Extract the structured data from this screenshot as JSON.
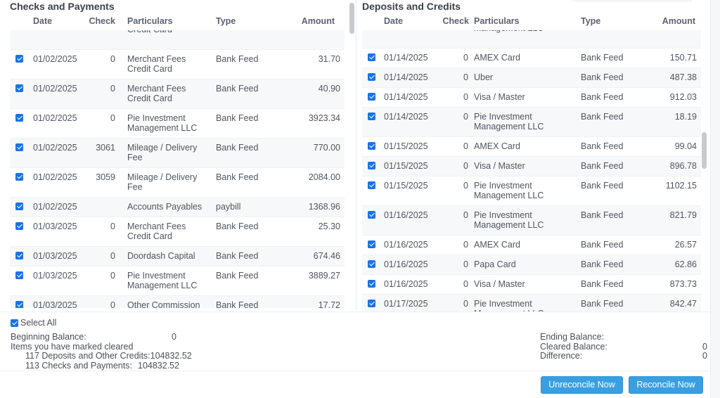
{
  "checks_panel": {
    "title": "Checks and Payments",
    "columns": [
      "Date",
      "Check",
      "Particulars",
      "Type",
      "Amount"
    ],
    "rows": [
      {
        "checked": true,
        "date": "",
        "check": "",
        "particulars": [
          "",
          "Credit Card"
        ],
        "type": "",
        "amount": "",
        "partial": true
      },
      {
        "checked": true,
        "date": "01/02/2025",
        "check": "0",
        "particulars": [
          "Merchant Fees",
          "Credit Card"
        ],
        "type": "Bank Feed",
        "amount": "31.70"
      },
      {
        "checked": true,
        "date": "01/02/2025",
        "check": "0",
        "particulars": [
          "Merchant Fees",
          "Credit Card"
        ],
        "type": "Bank Feed",
        "amount": "40.90"
      },
      {
        "checked": true,
        "date": "01/02/2025",
        "check": "0",
        "particulars": [
          "Pie Investment",
          "Management LLC"
        ],
        "type": "Bank Feed",
        "amount": "3923.34"
      },
      {
        "checked": true,
        "date": "01/02/2025",
        "check": "3061",
        "particulars": [
          "Mileage / Delivery",
          "Fee"
        ],
        "type": "Bank Feed",
        "amount": "770.00"
      },
      {
        "checked": true,
        "date": "01/02/2025",
        "check": "3059",
        "particulars": [
          "Mileage / Delivery",
          "Fee"
        ],
        "type": "Bank Feed",
        "amount": "2084.00"
      },
      {
        "checked": true,
        "date": "01/02/2025",
        "check": "",
        "particulars": [
          "Accounts Payables"
        ],
        "type": "paybill",
        "amount": "1368.96"
      },
      {
        "checked": true,
        "date": "01/03/2025",
        "check": "0",
        "particulars": [
          "Merchant Fees",
          "Credit Card"
        ],
        "type": "Bank Feed",
        "amount": "25.30"
      },
      {
        "checked": true,
        "date": "01/03/2025",
        "check": "0",
        "particulars": [
          "Doordash Capital"
        ],
        "type": "Bank Feed",
        "amount": "674.46"
      },
      {
        "checked": true,
        "date": "01/03/2025",
        "check": "0",
        "particulars": [
          "Pie Investment",
          "Management LLC"
        ],
        "type": "Bank Feed",
        "amount": "3889.27"
      },
      {
        "checked": true,
        "date": "01/03/2025",
        "check": "0",
        "particulars": [
          "Other Commission"
        ],
        "type": "Bank Feed",
        "amount": "17.72"
      }
    ]
  },
  "deposits_panel": {
    "title": "Deposits and Credits",
    "columns": [
      "Date",
      "Check",
      "Particulars",
      "Type",
      "Amount"
    ],
    "rows": [
      {
        "checked": true,
        "date": "",
        "check": "",
        "particulars": [
          "",
          "Management LLC"
        ],
        "type": "",
        "amount": "",
        "partial": true
      },
      {
        "checked": true,
        "date": "01/14/2025",
        "check": "0",
        "particulars": [
          "AMEX Card"
        ],
        "type": "Bank Feed",
        "amount": "150.71"
      },
      {
        "checked": true,
        "date": "01/14/2025",
        "check": "0",
        "particulars": [
          "Uber"
        ],
        "type": "Bank Feed",
        "amount": "487.38"
      },
      {
        "checked": true,
        "date": "01/14/2025",
        "check": "0",
        "particulars": [
          "Visa / Master"
        ],
        "type": "Bank Feed",
        "amount": "912.03"
      },
      {
        "checked": true,
        "date": "01/14/2025",
        "check": "0",
        "particulars": [
          "Pie Investment",
          "Management LLC"
        ],
        "type": "Bank Feed",
        "amount": "18.19"
      },
      {
        "checked": true,
        "date": "01/15/2025",
        "check": "0",
        "particulars": [
          "AMEX Card"
        ],
        "type": "Bank Feed",
        "amount": "99.04"
      },
      {
        "checked": true,
        "date": "01/15/2025",
        "check": "0",
        "particulars": [
          "Visa / Master"
        ],
        "type": "Bank Feed",
        "amount": "896.78"
      },
      {
        "checked": true,
        "date": "01/15/2025",
        "check": "0",
        "particulars": [
          "Pie Investment",
          "Management LLC"
        ],
        "type": "Bank Feed",
        "amount": "1102.15"
      },
      {
        "checked": true,
        "date": "01/16/2025",
        "check": "0",
        "particulars": [
          "Pie Investment",
          "Management LLC"
        ],
        "type": "Bank Feed",
        "amount": "821.79"
      },
      {
        "checked": true,
        "date": "01/16/2025",
        "check": "0",
        "particulars": [
          "AMEX Card"
        ],
        "type": "Bank Feed",
        "amount": "26.57"
      },
      {
        "checked": true,
        "date": "01/16/2025",
        "check": "0",
        "particulars": [
          "Papa Card"
        ],
        "type": "Bank Feed",
        "amount": "62.86"
      },
      {
        "checked": true,
        "date": "01/16/2025",
        "check": "0",
        "particulars": [
          "Visa / Master"
        ],
        "type": "Bank Feed",
        "amount": "873.73"
      },
      {
        "checked": true,
        "date": "01/17/2025",
        "check": "0",
        "particulars": [
          "Pie Investment",
          "Management LLC"
        ],
        "type": "Bank Feed",
        "amount": "842.47"
      }
    ]
  },
  "footer": {
    "select_all_label": "Select All",
    "select_all_checked": true,
    "beginning_balance_label": "Beginning Balance:",
    "beginning_balance_value": "0",
    "items_cleared_label": "Items you have marked cleared",
    "deposits_cleared_label": "117 Deposits and Other Credits:",
    "deposits_cleared_value": "104832.52",
    "checks_cleared_label": "113 Checks and Payments:",
    "checks_cleared_value": "104832.52",
    "ending_balance_label": "Ending Balance:",
    "ending_balance_value": "",
    "cleared_balance_label": "Cleared Balance:",
    "cleared_balance_value": "0",
    "difference_label": "Difference:",
    "difference_value": "0"
  },
  "buttons": {
    "unreconcile": "Unreconcile Now",
    "reconcile": "Reconcile Now"
  },
  "colors": {
    "button_blue": "#3a9fe0",
    "checkbox_blue": "#1a73e8"
  }
}
